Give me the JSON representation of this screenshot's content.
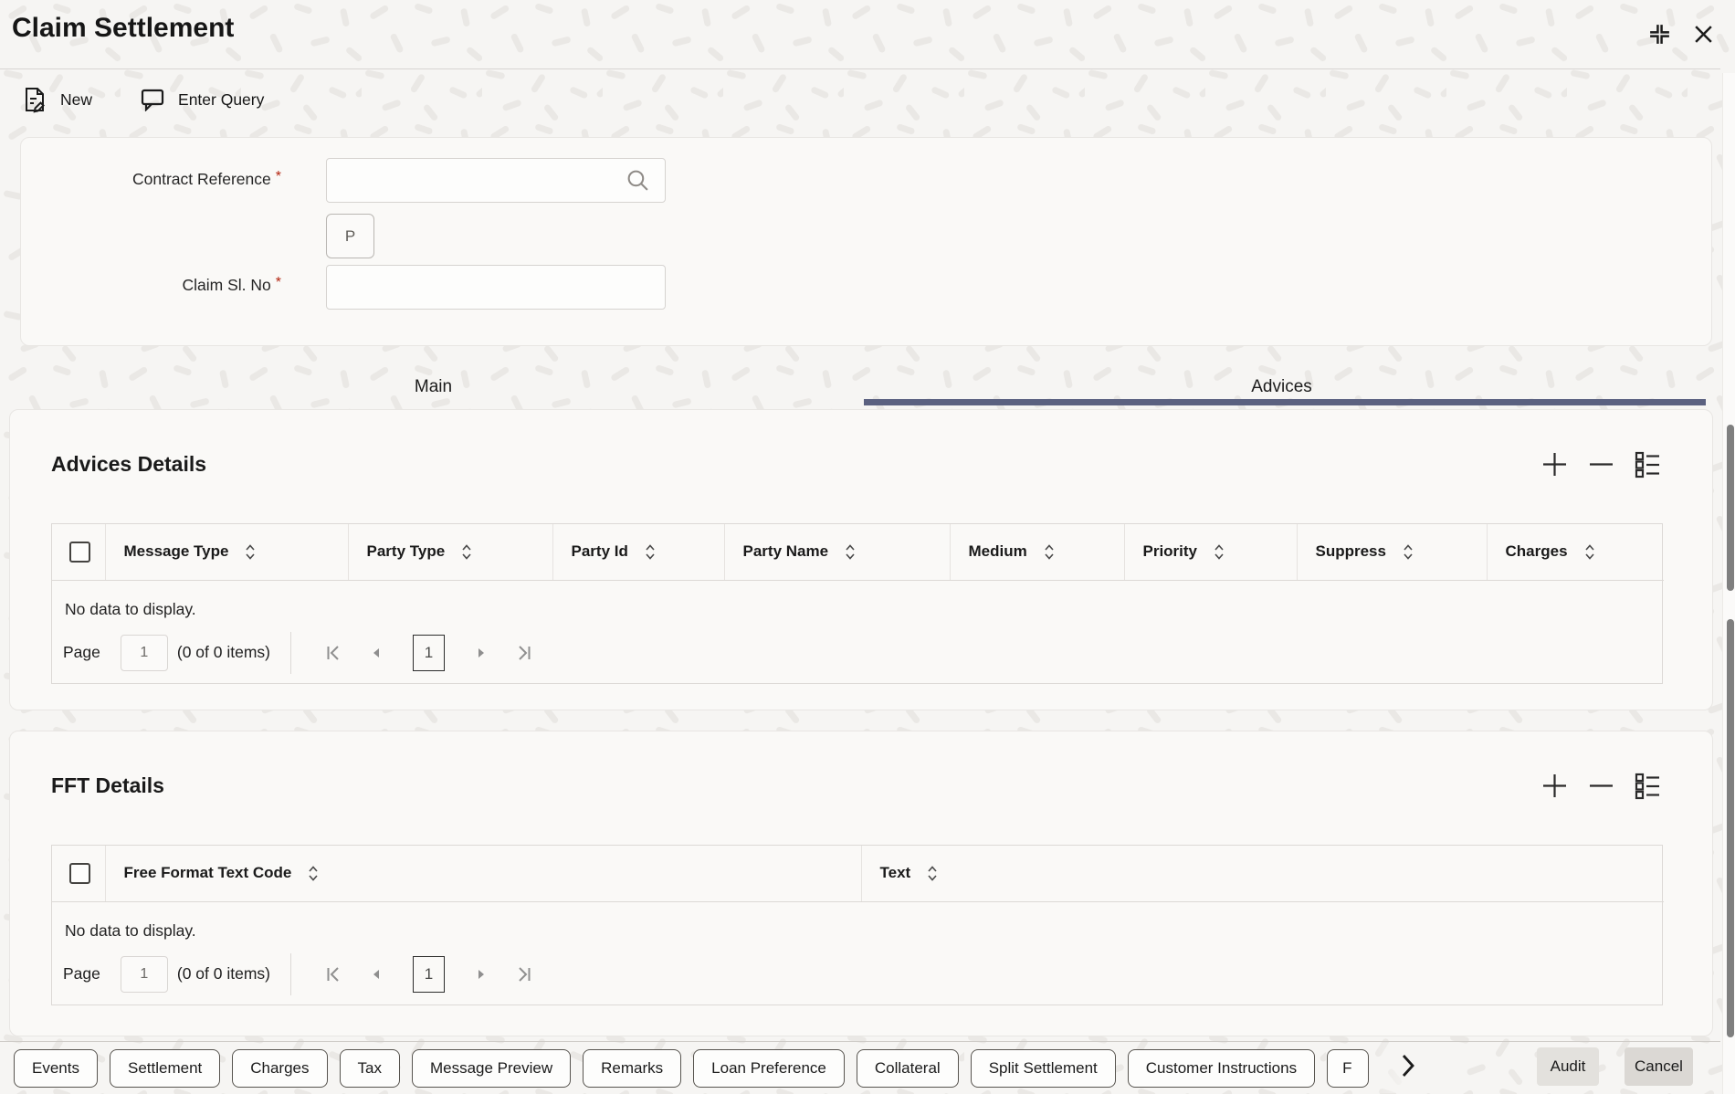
{
  "window_title": "Claim Settlement",
  "toolbar": {
    "new": "New",
    "enter_query": "Enter Query"
  },
  "form": {
    "contract_reference_label": "Contract Reference",
    "contract_reference_value": "",
    "claim_sl_no_label": "Claim Sl. No",
    "claim_sl_no_value": "",
    "required_marker": "*",
    "p_button": "P"
  },
  "tabs": {
    "main": "Main",
    "advices": "Advices",
    "active_tab": "Advices"
  },
  "advices_section": {
    "title": "Advices Details",
    "columns": [
      "Message Type",
      "Party Type",
      "Party Id",
      "Party Name",
      "Medium",
      "Priority",
      "Suppress",
      "Charges"
    ],
    "empty_text": "No data to display.",
    "pager": {
      "page_label": "Page",
      "page_input": "1",
      "items_text": "(0 of 0 items)",
      "current_page": "1"
    }
  },
  "fft_section": {
    "title": "FFT Details",
    "columns": [
      "Free Format Text Code",
      "Text"
    ],
    "empty_text": "No data to display.",
    "pager": {
      "page_label": "Page",
      "page_input": "1",
      "items_text": "(0 of 0 items)",
      "current_page": "1"
    }
  },
  "footer": {
    "buttons": [
      "Events",
      "Settlement",
      "Charges",
      "Tax",
      "Message Preview",
      "Remarks",
      "Loan Preference",
      "Collateral",
      "Split Settlement",
      "Customer Instructions",
      "F"
    ],
    "audit": "Audit",
    "cancel": "Cancel"
  },
  "colors": {
    "tab_underline": "#5b6180",
    "required": "#b3240f"
  }
}
